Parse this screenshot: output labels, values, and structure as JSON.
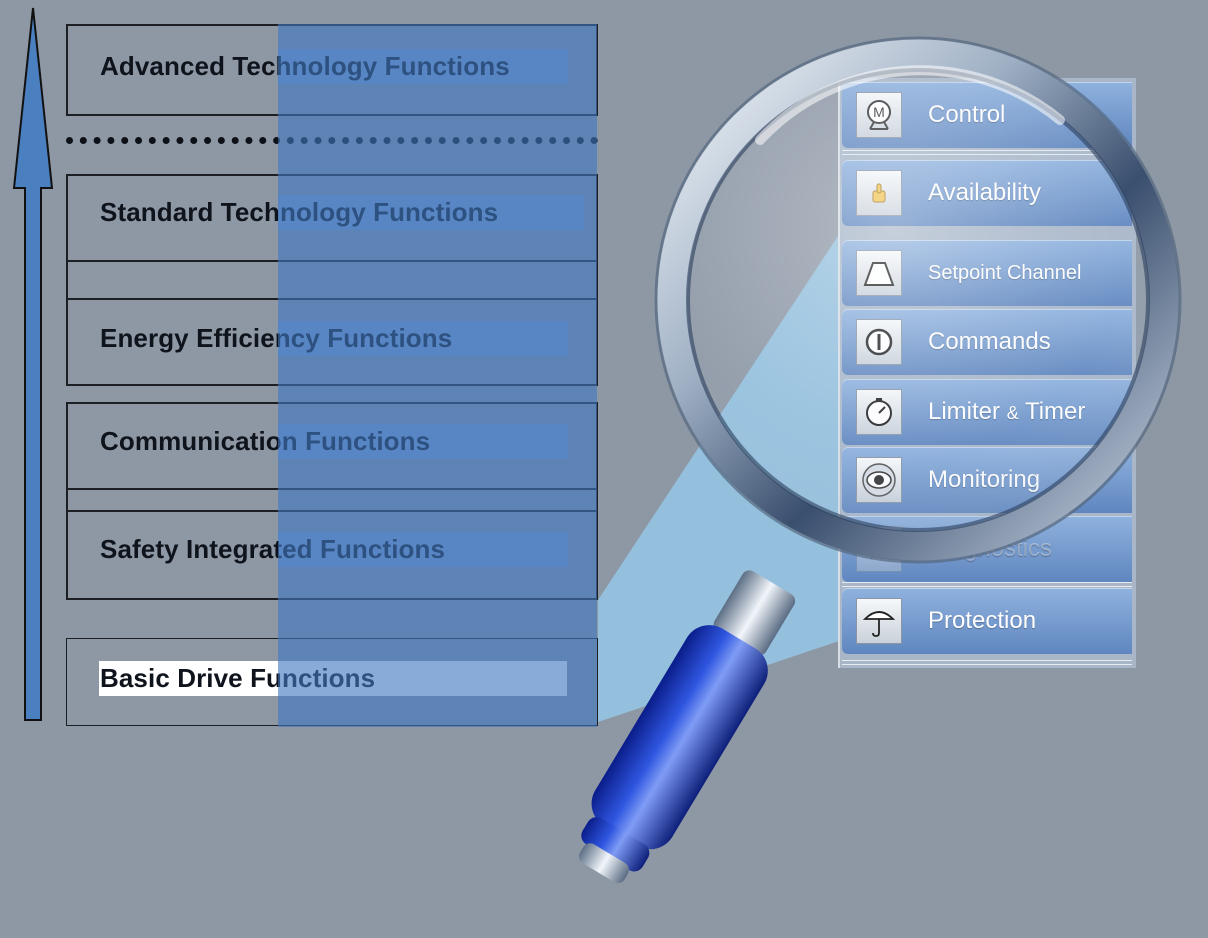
{
  "layers": [
    {
      "label": "Advanced Technology Functions"
    },
    {
      "label": "Standard Technology Functions"
    },
    {
      "label": "Energy Efficiency Functions"
    },
    {
      "label": "Communication Functions"
    },
    {
      "label": "Safety Integrated Functions"
    },
    {
      "label": "Basic Drive Functions"
    }
  ],
  "menu": {
    "items": [
      {
        "label": "Control",
        "icon": "motor-icon"
      },
      {
        "label": "Availability",
        "icon": "thumbs-up-icon"
      },
      {
        "label": "Setpoint Channel",
        "icon": "trapezoid-ramp-icon"
      },
      {
        "label": "Commands",
        "icon": "power-icon"
      },
      {
        "label_main": "Limiter",
        "label_amp": "&",
        "label_tail": "Timer",
        "icon": "stopwatch-icon"
      },
      {
        "label": "Monitoring",
        "icon": "eye-icon"
      },
      {
        "label": "Diagnostics",
        "icon": "diagnostics-icon"
      },
      {
        "label": "Protection",
        "icon": "umbrella-icon"
      }
    ]
  },
  "colors": {
    "background": "#8e98a5",
    "overlay_blue": "#4078be",
    "arrow_blue": "#4a7fc0",
    "menu_blue": "#6f95cb",
    "handle_blue": "#1f3fbf"
  }
}
